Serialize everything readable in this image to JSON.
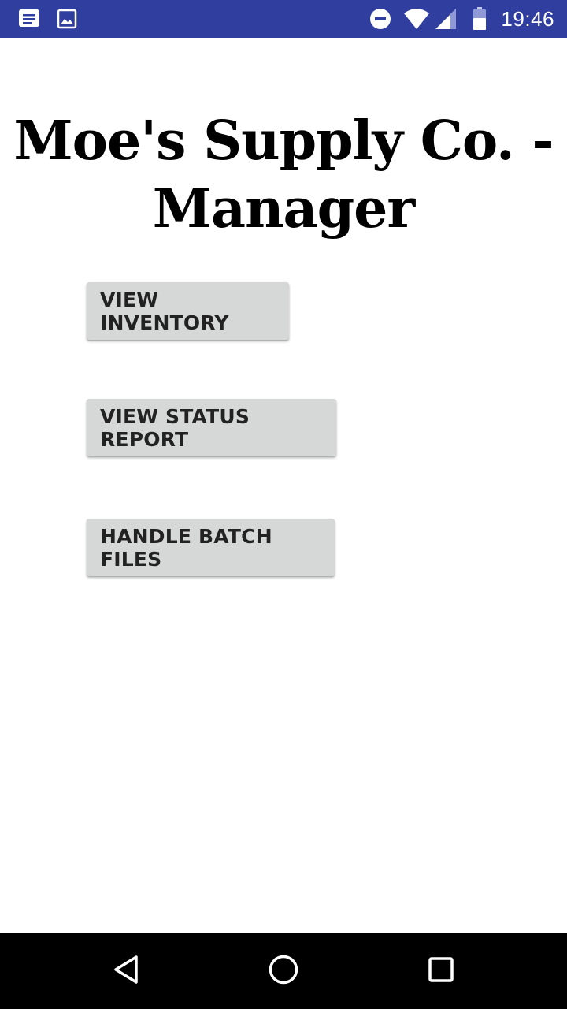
{
  "status_bar": {
    "time": "19:46",
    "icons": [
      "notification-icon",
      "image-notification-icon",
      "do-not-disturb-icon",
      "wifi-icon",
      "cell-signal-icon",
      "battery-icon"
    ]
  },
  "app": {
    "title": "Moe's Supply Co. - Manager",
    "buttons": {
      "view_inventory": "VIEW INVENTORY",
      "view_status_report": "VIEW STATUS REPORT",
      "handle_batch_files": "HANDLE BATCH FILES"
    },
    "button_color": "#d6d7d7"
  },
  "navigation_bar": {
    "icons": [
      "back-icon",
      "home-icon",
      "recents-icon"
    ]
  },
  "colors": {
    "status_bar": "#303f9f",
    "background": "#ffffff",
    "navigation_bar": "#000000"
  }
}
